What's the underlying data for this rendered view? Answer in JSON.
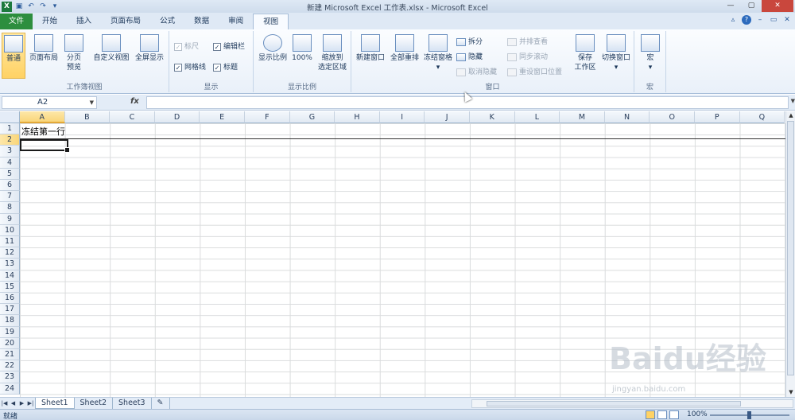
{
  "window": {
    "title": "新建 Microsoft Excel 工作表.xlsx - Microsoft Excel",
    "controls": [
      "—",
      "▢",
      "✕"
    ]
  },
  "qat": {
    "app_icon": "X",
    "icons": [
      "save-icon",
      "undo-icon",
      "redo-icon",
      "customize-icon"
    ]
  },
  "tabs": {
    "file": "文件",
    "items": [
      "开始",
      "插入",
      "页面布局",
      "公式",
      "数据",
      "审阅",
      "视图"
    ],
    "active": "视图"
  },
  "ribbon": {
    "groups": {
      "workbook_views": {
        "label": "工作簿视图",
        "normal": "普通",
        "page_layout": "页面布局",
        "page_break_1": "分页",
        "page_break_2": "预览",
        "custom_views": "自定义视图",
        "full_screen": "全屏显示"
      },
      "show": {
        "label": "显示",
        "ruler": "标尺",
        "formula_bar": "编辑栏",
        "gridlines": "网格线",
        "headings": "标题",
        "checks": {
          "ruler": false,
          "formula_bar": true,
          "gridlines": true,
          "headings": true
        }
      },
      "zoom": {
        "label": "显示比例",
        "zoom": "显示比例",
        "hundred": "100%",
        "zoom_sel_1": "缩放到",
        "zoom_sel_2": "选定区域"
      },
      "window": {
        "label": "窗口",
        "new_window": "新建窗口",
        "arrange_all": "全部重排",
        "freeze_panes": "冻结窗格",
        "split": "拆分",
        "hide": "隐藏",
        "unhide": "取消隐藏",
        "side_by_side": "并排查看",
        "sync_scroll": "同步滚动",
        "reset_pos": "重设窗口位置",
        "save_ws_1": "保存",
        "save_ws_2": "工作区",
        "switch_windows": "切换窗口"
      },
      "macros": {
        "label": "宏",
        "macros": "宏"
      }
    }
  },
  "formula_bar": {
    "name_box": "A2",
    "fx": "fx",
    "content": ""
  },
  "sheet": {
    "columns": [
      "A",
      "B",
      "C",
      "D",
      "E",
      "F",
      "G",
      "H",
      "I",
      "J",
      "K",
      "L",
      "M",
      "N",
      "O",
      "P",
      "Q"
    ],
    "rows": [
      "1",
      "2",
      "3",
      "4",
      "5",
      "6",
      "7",
      "8",
      "9",
      "10",
      "11",
      "12",
      "13",
      "14",
      "15",
      "16",
      "17",
      "18",
      "19",
      "20",
      "21",
      "22",
      "23",
      "24"
    ],
    "selected_column": "A",
    "selected_row": "2",
    "cells": {
      "A1": "冻结第一行"
    }
  },
  "sheet_tabs": {
    "items": [
      "Sheet1",
      "Sheet2",
      "Sheet3"
    ],
    "active": "Sheet1"
  },
  "status_bar": {
    "status": "就绪",
    "zoom": "100%",
    "zoom_level_percent": 100
  },
  "watermark": {
    "text": "Baidu经验",
    "url": "jingyan.baidu.com"
  }
}
